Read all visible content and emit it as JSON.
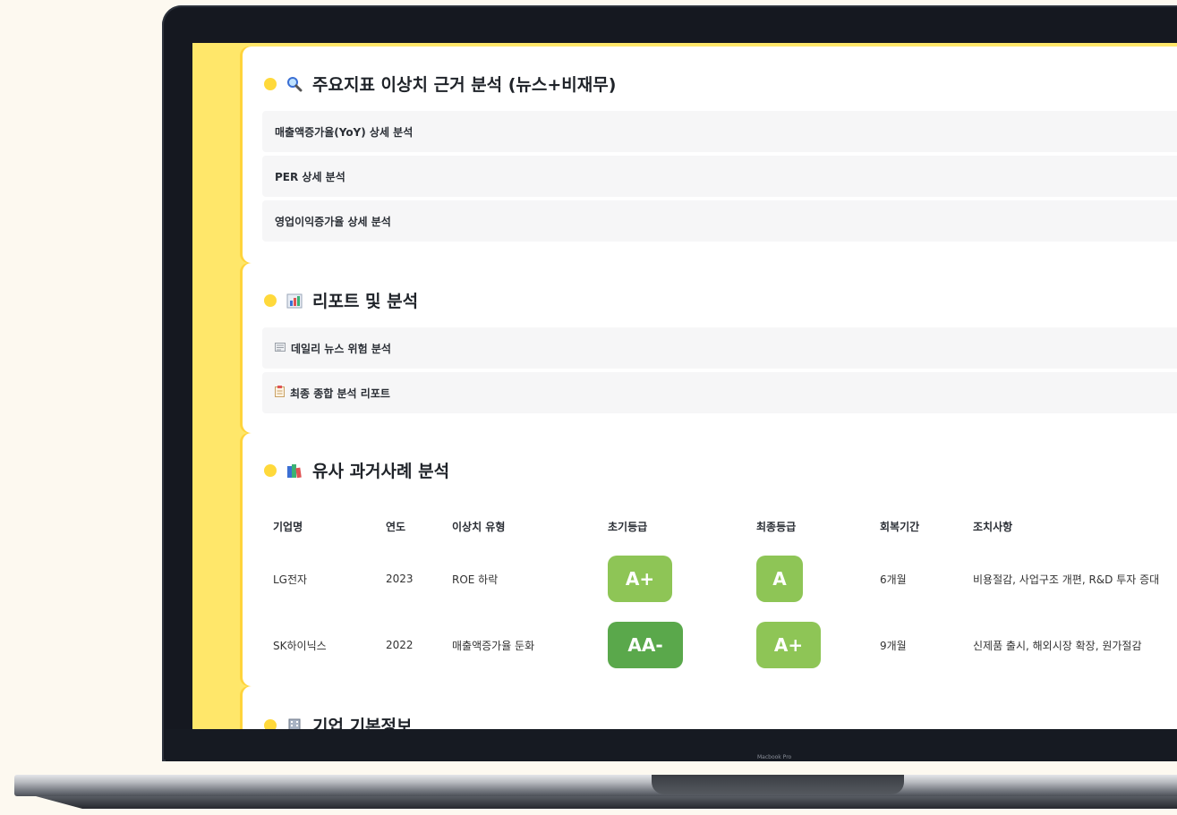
{
  "device": {
    "model_label": "Macbook Pro"
  },
  "colors": {
    "accent_yellow": "#ffd93b",
    "grade_green": "#8ec556",
    "grade_dark_green": "#5aa84b"
  },
  "section1": {
    "icon": "magnifier-icon",
    "title": "주요지표 이상치 근거 분석 (뉴스+비재무)",
    "items": [
      "매출액증가율(YoY) 상세 분석",
      "PER 상세 분석",
      "영업이익증가율 상세 분석"
    ]
  },
  "section2": {
    "icon": "bar-chart-icon",
    "title": "리포트 및 분석",
    "items": [
      {
        "icon": "newspaper-icon",
        "label": "데일리 뉴스 위험 분석"
      },
      {
        "icon": "clipboard-icon",
        "label": "최종 종합 분석 리포트"
      }
    ]
  },
  "section3": {
    "icon": "books-icon",
    "title": "유사 과거사례 분석",
    "headers": [
      "기업명",
      "연도",
      "이상치 유형",
      "초기등급",
      "최종등급",
      "회복기간",
      "조치사항"
    ],
    "rows": [
      {
        "company": "LG전자",
        "year": "2023",
        "type": "ROE 하락",
        "initial": "A+",
        "final": "A",
        "period": "6개월",
        "action": "비용절감, 사업구조 개편, R&D 투자 증대"
      },
      {
        "company": "SK하이닉스",
        "year": "2022",
        "type": "매출액증가율 둔화",
        "initial": "AA-",
        "final": "A+",
        "period": "9개월",
        "action": "신제품 출시, 해외시장 확장, 원가절감"
      }
    ]
  },
  "section4": {
    "icon": "building-icon",
    "title": "기업 기본정보"
  }
}
